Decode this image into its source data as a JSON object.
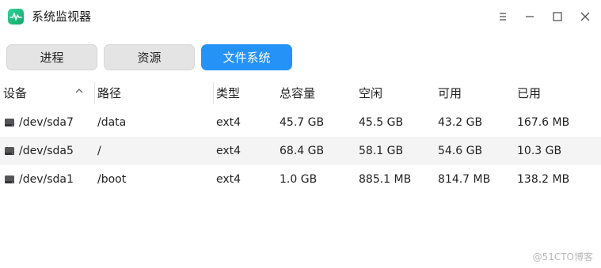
{
  "window": {
    "title": "系统监视器",
    "icon": "activity-monitor-icon"
  },
  "window_controls": {
    "menu_icon": "hamburger-menu-icon",
    "minimize_icon": "minimize-icon",
    "maximize_icon": "maximize-icon",
    "close_icon": "close-icon"
  },
  "tabs": [
    {
      "label": "进程",
      "active": false
    },
    {
      "label": "资源",
      "active": false
    },
    {
      "label": "文件系统",
      "active": true
    }
  ],
  "table": {
    "columns": [
      "设备",
      "路径",
      "类型",
      "总容量",
      "空闲",
      "可用",
      "已用"
    ],
    "sort_column": "设备",
    "rows": [
      {
        "device": "/dev/sda7",
        "path": "/data",
        "type": "ext4",
        "total": "45.7 GB",
        "free": "45.5 GB",
        "available": "43.2 GB",
        "used": "167.6 MB"
      },
      {
        "device": "/dev/sda5",
        "path": "/",
        "type": "ext4",
        "total": "68.4 GB",
        "free": "58.1 GB",
        "available": "54.6 GB",
        "used": "10.3 GB"
      },
      {
        "device": "/dev/sda1",
        "path": "/boot",
        "type": "ext4",
        "total": "1.0 GB",
        "free": "885.1 MB",
        "available": "814.7 MB",
        "used": "138.2 MB"
      }
    ]
  },
  "watermark": "@51CTO博客",
  "colors": {
    "accent": "#2492f6",
    "tab_inactive": "#e4e4e4",
    "row_alt": "#f4f4f4",
    "app_icon": "#1fbf80"
  }
}
